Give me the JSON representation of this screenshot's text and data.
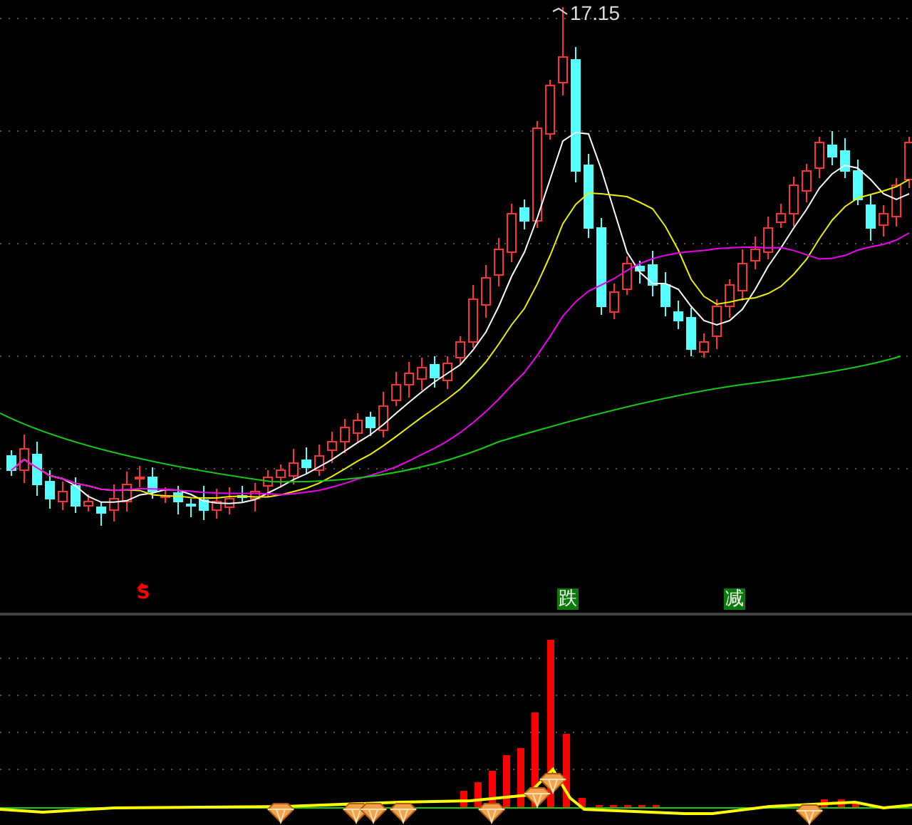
{
  "price_panel": {
    "high_label": "17.15"
  },
  "signals": [
    {
      "text": "S",
      "kind": "sell"
    },
    {
      "text": "跌",
      "kind": "tag"
    },
    {
      "text": "减",
      "kind": "tag"
    }
  ]
}
